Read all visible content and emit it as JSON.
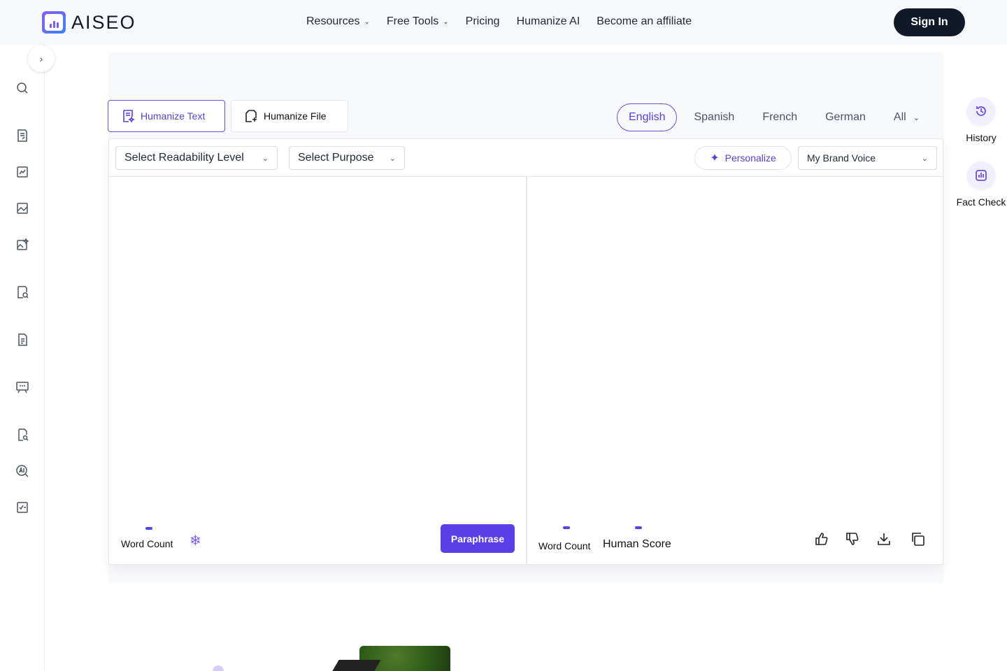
{
  "brand": {
    "name": "AISEO"
  },
  "nav": {
    "items": [
      {
        "label": "Resources",
        "has_menu": true
      },
      {
        "label": "Free Tools",
        "has_menu": true
      },
      {
        "label": "Pricing",
        "has_menu": false
      },
      {
        "label": "Humanize AI",
        "has_menu": false
      },
      {
        "label": "Become an affiliate",
        "has_menu": false
      }
    ],
    "signin_label": "Sign In"
  },
  "sidebar": {
    "collapse_icon": "chevron-right-icon",
    "icons": [
      "search-icon",
      "document-edit-icon",
      "chart-icon",
      "image-icon",
      "image-sparkle-icon",
      "document-search-icon",
      "document-text-icon",
      "presentation-icon",
      "file-search-icon",
      "ai-search-icon",
      "checklist-icon"
    ]
  },
  "modes": {
    "humanize_text": "Humanize Text",
    "humanize_file": "Humanize File"
  },
  "languages": {
    "items": [
      "English",
      "Spanish",
      "French",
      "German"
    ],
    "selected": "English",
    "all_label": "All"
  },
  "toolbar": {
    "readability": "Select Readability Level",
    "purpose": "Select Purpose",
    "personalize": "Personalize",
    "brand_voice": "My Brand Voice"
  },
  "input_pane": {
    "word_count_label": "Word Count",
    "paraphrase_label": "Paraphrase"
  },
  "output_pane": {
    "word_count_label": "Word Count",
    "human_score_label": "Human Score",
    "actions": [
      "thumbs-up-icon",
      "thumbs-down-icon",
      "download-icon",
      "copy-icon"
    ]
  },
  "right_rail": {
    "history_label": "History",
    "fact_check_label": "Fact Check"
  },
  "colors": {
    "accent": "#5b3fe6",
    "dark": "#111827",
    "border": "#e5e7eb"
  }
}
